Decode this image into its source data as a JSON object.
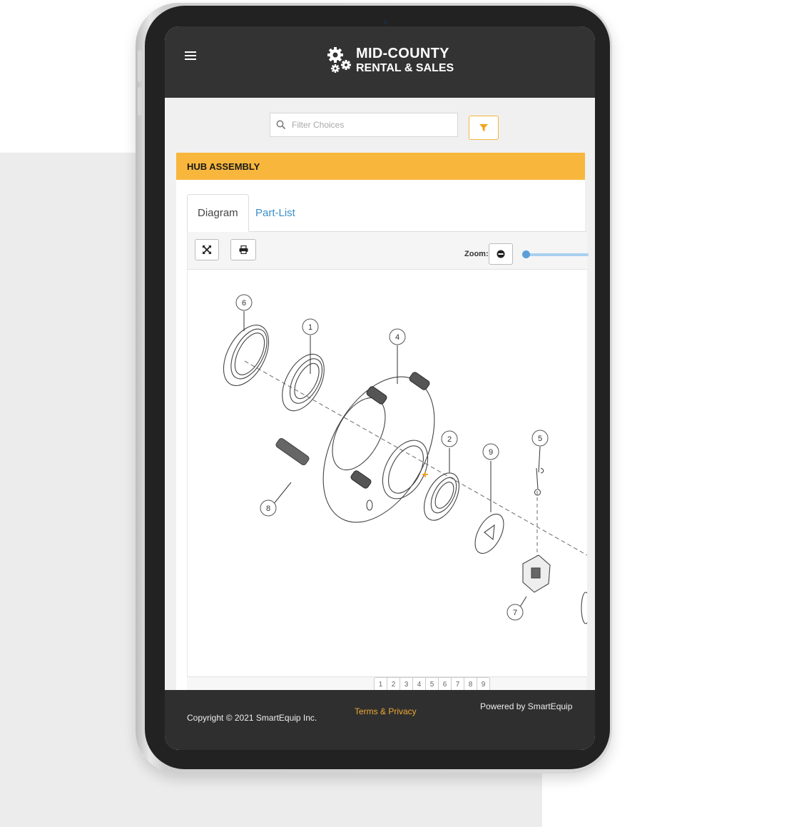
{
  "header": {
    "brand_line1": "MID-COUNTY",
    "brand_line2": "RENTAL & SALES",
    "menu_icon": "hamburger-icon",
    "logo_icon": "gears-icon"
  },
  "filter": {
    "placeholder": "Filter Choices",
    "value": "",
    "search_icon": "search-icon",
    "filter_button_icon": "funnel-icon"
  },
  "section": {
    "title": "HUB ASSEMBLY"
  },
  "tabs": [
    {
      "label": "Diagram",
      "active": true
    },
    {
      "label": "Part-List",
      "active": false
    }
  ],
  "toolbar": {
    "fullscreen_icon": "expand-icon",
    "print_icon": "printer-icon",
    "zoom_label": "Zoom:",
    "zoom_out_icon": "minus-circle-icon",
    "zoom_level": 0
  },
  "diagram": {
    "callouts": [
      "6",
      "1",
      "4",
      "2",
      "9",
      "5",
      "8",
      "7"
    ],
    "hotspot_marker": "+"
  },
  "pager": {
    "pages": [
      "1",
      "2",
      "3",
      "4",
      "5",
      "6",
      "7",
      "8",
      "9"
    ]
  },
  "footer": {
    "copyright": "Copyright © 2021 SmartEquip Inc.",
    "terms_link": "Terms & Privacy",
    "powered_by": "Powered by SmartEquip"
  },
  "colors": {
    "accent": "#f8b73c",
    "header_bg": "#333333",
    "link": "#3b8ec9",
    "footer_link": "#f0a933"
  }
}
